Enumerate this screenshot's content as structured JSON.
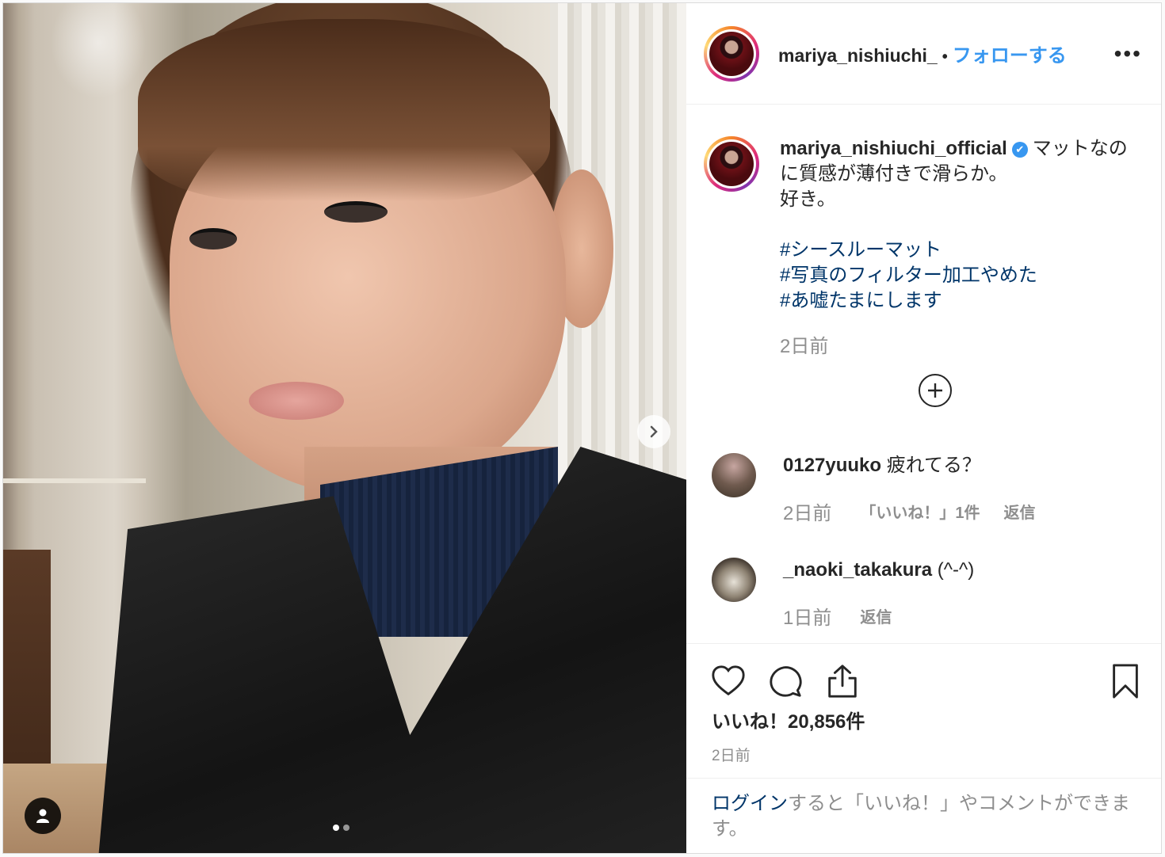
{
  "post": {
    "author": "mariya_nishiuchi_",
    "bullet": "•",
    "follow_label": "フォローする",
    "more_label": "•••"
  },
  "caption": {
    "user": "mariya_nishiuchi_official",
    "verified_icon": "✔",
    "text": "マットなのに質感が薄付きで滑らか。",
    "text2": "好き。",
    "hashtags": [
      "#シースルーマット",
      "#写真のフィルター加工やめた",
      "#あ嘘たまにします"
    ],
    "time": "2日前"
  },
  "load_more_icon": "plus-circle-icon",
  "comments": [
    {
      "user": "0127yuuko",
      "text": "疲れてる？",
      "time": "2日前",
      "likes": "「いいね！」1件",
      "reply": "返信"
    },
    {
      "user": "_naoki_takakura",
      "text": "(^-^)",
      "time": "1日前",
      "reply": "返信"
    }
  ],
  "actions": {
    "icons": [
      "heart-icon",
      "comment-icon",
      "share-icon",
      "bookmark-icon"
    ],
    "likes_label": "いいね！20,856件",
    "time": "2日前"
  },
  "login": {
    "link": "ログイン",
    "rest": "すると「いいね！」やコメントができます。"
  },
  "carousel": {
    "current": 1,
    "total": 2
  },
  "colors": {
    "accent": "#3897f0",
    "hashtag": "#003569",
    "muted": "#8e8e8e",
    "text": "#262626"
  }
}
